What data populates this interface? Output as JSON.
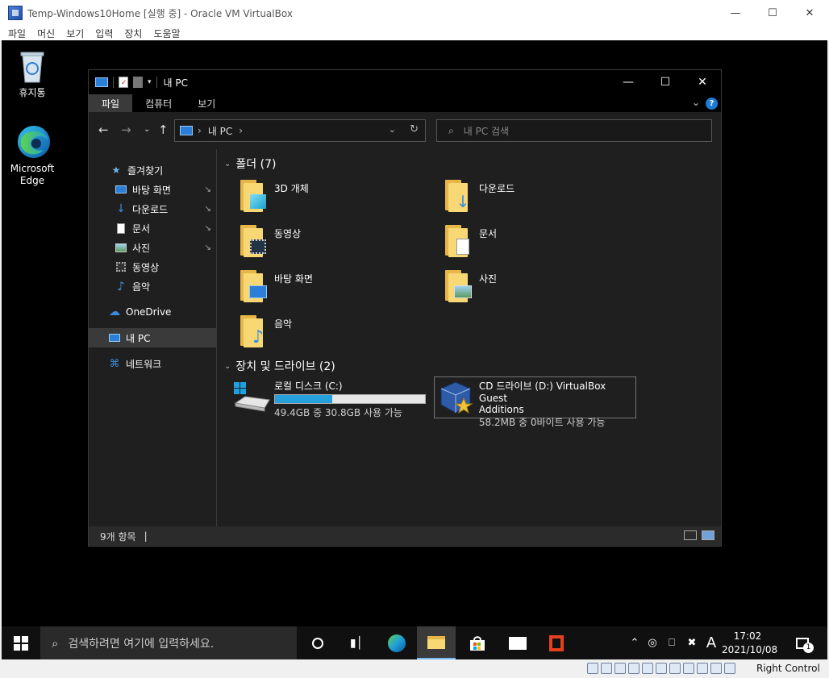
{
  "vbox": {
    "title": "Temp-Windows10Home [실행 중] - Oracle VM VirtualBox",
    "menu": [
      "파일",
      "머신",
      "보기",
      "입력",
      "장치",
      "도움말"
    ],
    "host_key": "Right Control"
  },
  "desktop": {
    "icons": [
      {
        "label": "휴지통"
      },
      {
        "label": "Microsoft Edge"
      }
    ]
  },
  "explorer": {
    "title": "내 PC",
    "ribbon_tabs": [
      "파일",
      "컴퓨터",
      "보기"
    ],
    "help": "?",
    "address": [
      "내 PC",
      "›"
    ],
    "search_placeholder": "내 PC 검색",
    "sidebar": [
      {
        "label": "즐겨찾기",
        "pinned": false
      },
      {
        "label": "바탕 화면",
        "pinned": true
      },
      {
        "label": "다운로드",
        "pinned": true
      },
      {
        "label": "문서",
        "pinned": true
      },
      {
        "label": "사진",
        "pinned": true
      },
      {
        "label": "동영상",
        "pinned": false
      },
      {
        "label": "음악",
        "pinned": false
      },
      {
        "label": "OneDrive",
        "pinned": false
      },
      {
        "label": "내 PC",
        "pinned": false
      },
      {
        "label": "네트워크",
        "pinned": false
      }
    ],
    "folders_header": "폴더 (7)",
    "folders": [
      {
        "name": "3D 개체"
      },
      {
        "name": "다운로드"
      },
      {
        "name": "동영상"
      },
      {
        "name": "문서"
      },
      {
        "name": "바탕 화면"
      },
      {
        "name": "사진"
      },
      {
        "name": "음악"
      }
    ],
    "drives_header": "장치 및 드라이브 (2)",
    "drives": [
      {
        "name": "로컬 디스크 (C:)",
        "detail": "49.4GB 중 30.8GB 사용 가능",
        "used_fraction": 0.38
      },
      {
        "name": "CD 드라이브 (D:) VirtualBox Guest",
        "name2": "Additions",
        "detail": "58.2MB 중 0바이트 사용 가능"
      }
    ],
    "status": "9개 항목",
    "status_sep": "|"
  },
  "taskbar": {
    "search_placeholder": "검색하려면 여기에 입력하세요.",
    "ime": "A",
    "time": "17:02",
    "date": "2021/10/08",
    "notification_count": "1"
  },
  "colors": {
    "accent": "#26a0da",
    "folder": "#f8d775",
    "explorer_bg": "#1f1f1f"
  }
}
